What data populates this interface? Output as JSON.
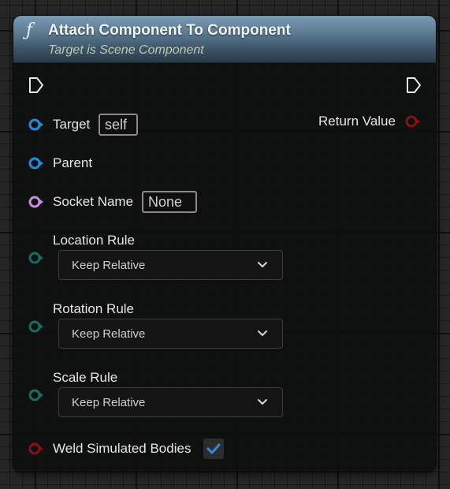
{
  "node": {
    "title": "Attach Component To Component",
    "subtitle": "Target is Scene Component",
    "function_icon": "ƒ"
  },
  "pins": {
    "target": {
      "label": "Target",
      "value": "self"
    },
    "parent": {
      "label": "Parent"
    },
    "socket_name": {
      "label": "Socket Name",
      "value": "None"
    },
    "location_rule": {
      "label": "Location Rule",
      "selected": "Keep Relative"
    },
    "rotation_rule": {
      "label": "Rotation Rule",
      "selected": "Keep Relative"
    },
    "scale_rule": {
      "label": "Scale Rule",
      "selected": "Keep Relative"
    },
    "weld_simulated_bodies": {
      "label": "Weld Simulated Bodies",
      "checked": true
    },
    "return_value": {
      "label": "Return Value"
    }
  },
  "colors": {
    "object_pin": "#1a8fe0",
    "name_pin": "#c78de0",
    "enum_pin": "#1a6a64",
    "bool_pin": "#8a1010",
    "return_pin": "#8a1010",
    "checkbox_accent": "#2f8de4"
  }
}
